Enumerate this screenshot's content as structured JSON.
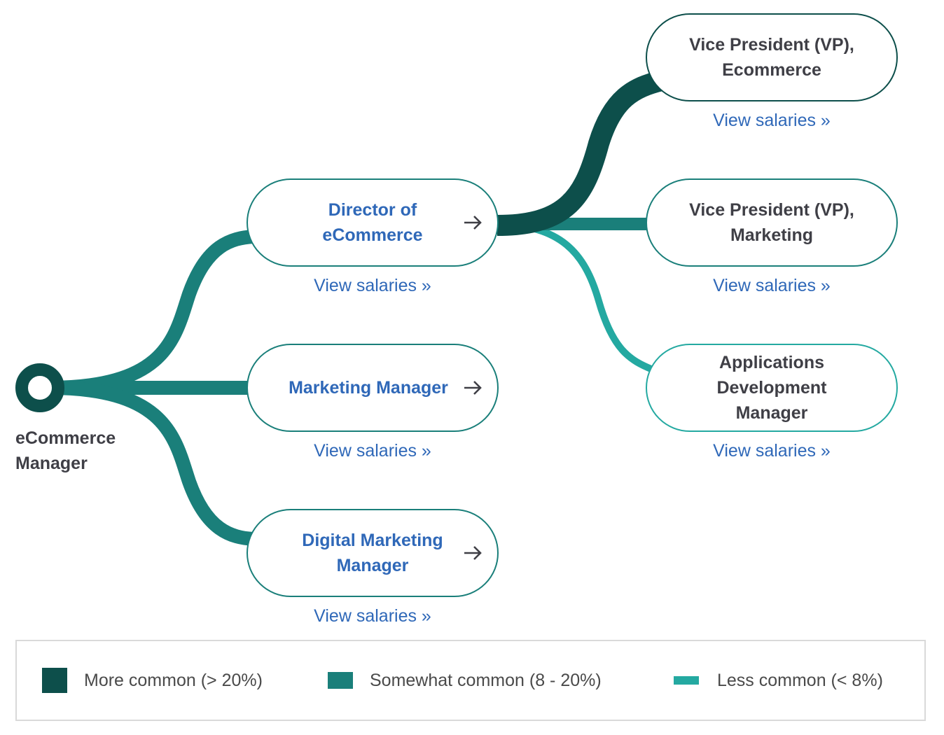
{
  "colors": {
    "more_common": "#0d4f4b",
    "somewhat_common": "#1a7f7a",
    "less_common": "#24a9a1",
    "link": "#2f68b8",
    "text": "#3f3f46"
  },
  "origin": {
    "title": "eCommerce Manager"
  },
  "next_steps": [
    {
      "title": "Director of eCommerce",
      "frequency": "somewhat_common",
      "link": "View salaries »"
    },
    {
      "title": "Marketing Manager",
      "frequency": "somewhat_common",
      "link": "View salaries »"
    },
    {
      "title": "Digital Marketing Manager",
      "frequency": "somewhat_common",
      "link": "View salaries »"
    }
  ],
  "director_next_steps": [
    {
      "title": "Vice President (VP), Ecommerce",
      "frequency": "more_common",
      "link": "View salaries »"
    },
    {
      "title": "Vice President (VP), Marketing",
      "frequency": "somewhat_common",
      "link": "View salaries »"
    },
    {
      "title": "Applications Development Manager",
      "frequency": "less_common",
      "link": "View salaries »"
    }
  ],
  "legend": [
    {
      "key": "more_common",
      "label": "More common (> 20%)"
    },
    {
      "key": "somewhat_common",
      "label": "Somewhat common (8 - 20%)"
    },
    {
      "key": "less_common",
      "label": "Less common (< 8%)"
    }
  ]
}
